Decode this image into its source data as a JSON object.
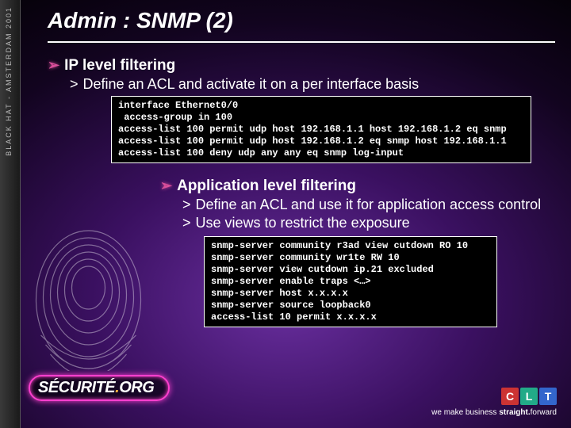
{
  "left_strip": "BLACK HAT - AMSTERDAM 2001",
  "title": "Admin : SNMP (2)",
  "section1": {
    "heading": "IP level filtering",
    "sub1": "Define an ACL and activate it on a per interface basis",
    "code": "interface Ethernet0/0\n access-group in 100\naccess-list 100 permit udp host 192.168.1.1 host 192.168.1.2 eq snmp\naccess-list 100 permit udp host 192.168.1.2 eq snmp host 192.168.1.1\naccess-list 100 deny udp any any eq snmp log-input"
  },
  "section2": {
    "heading": "Application level filtering",
    "sub1": "Define an ACL and use it for application access control",
    "sub2": "Use views to restrict the exposure",
    "code": "snmp-server community r3ad view cutdown RO 10\nsnmp-server community wr1te RW 10\nsnmp-server view cutdown ip.21 excluded\nsnmp-server enable traps <…>\nsnmp-server host x.x.x.x\nsnmp-server source loopback0\naccess-list 10 permit x.x.x.x"
  },
  "logo": {
    "text_before": "S",
    "text_mid": "ÉCURITÉ",
    "dot": ".",
    "org": "ORG"
  },
  "footer": {
    "c": "C",
    "l": "L",
    "t": "T",
    "tagline_pre": "we make business ",
    "tagline_bold": "straight.",
    "tagline_post": "forward"
  }
}
